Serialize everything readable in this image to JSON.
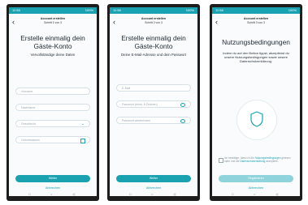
{
  "status_bar": {
    "left": "11:58",
    "right": "100%"
  },
  "screens": [
    {
      "header_title": "Account erstellen",
      "header_step": "Schritt 1 von 3",
      "title_line1": "Erstelle einmalig dein",
      "title_line2": "Gäste-Konto",
      "subtitle": "Vervollständige deine Daten",
      "fields": [
        {
          "label": "Vorname"
        },
        {
          "label": "Nachname"
        },
        {
          "label": "Geschlecht"
        },
        {
          "label": "Geburtsdatum"
        }
      ],
      "primary_button": "Weiter",
      "cancel": "Abbrechen"
    },
    {
      "header_title": "Account erstellen",
      "header_step": "Schritt 2 von 3",
      "title_line1": "Erstelle einmalig dein",
      "title_line2": "Gäste-Konto",
      "subtitle": "Deine E-Mail-Adresse und dein Passwort",
      "fields": [
        {
          "label": "E-Mail"
        },
        {
          "label": "Passwort (mind. 8 Zeichen)"
        },
        {
          "label": "Passwort wiederholen"
        }
      ],
      "primary_button": "Weiter",
      "cancel": "Abbrechen"
    },
    {
      "header_title": "Account erstellen",
      "header_step": "Schritt 3 von 3",
      "title_line1": "Nutzungsbedingungen",
      "subtitle": "Indem du auf den Button tippst, akzeptierst du unsere Nutzungsbedingungen sowie unsere Datenschutzerklärung.",
      "consent_prefix": "Ich bestätige, dass ich die",
      "consent_link1": "Nutzungsbedingungen",
      "consent_middle": "gelesen habe und die",
      "consent_link2": "Datenschutzerklärung",
      "consent_suffix": "akzeptiere.",
      "primary_button": "Registrieren",
      "cancel": "Abbrechen"
    }
  ],
  "nav": {
    "home": "□",
    "recent": "○",
    "back": "◁"
  },
  "icons": {
    "back": "chevron-left-icon",
    "dropdown": "chevron-down-icon",
    "calendar": "calendar-icon",
    "password_visibility": "eye-icon",
    "shield": "shield-icon"
  },
  "colors": {
    "accent": "#19a2b2",
    "accent_disabled": "#8fd4dc",
    "screen_bg": "#f9fbfc",
    "text_dark": "#1f2a33",
    "placeholder": "#9aa6ae",
    "device_frame": "#1d1d1d"
  }
}
